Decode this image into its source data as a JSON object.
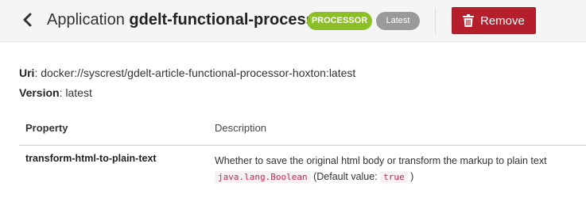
{
  "header": {
    "title_prefix": "Application",
    "app_name": "gdelt-functional-processor",
    "type_badge": "PROCESSOR",
    "version_badge": "Latest",
    "remove_label": "Remove",
    "icons": {
      "back": "chevron-left-icon",
      "remove": "trash-icon"
    },
    "colors": {
      "type_badge": "#8cbf26",
      "version_badge": "#9a9a9a",
      "remove_button": "#b51f2b"
    }
  },
  "details": {
    "uri_label": "Uri",
    "uri_value": "docker://syscrest/gdelt-article-functional-processor-hoxton:latest",
    "version_label": "Version",
    "version_value": "latest"
  },
  "properties_table": {
    "columns": [
      "Property",
      "Description"
    ],
    "rows": [
      {
        "property": "transform-html-to-plain-text",
        "description": "Whether to save the original html body or transform the markup to plain text",
        "type": "java.lang.Boolean",
        "default_prefix": "(Default value:",
        "default_value": "true",
        "default_suffix": ")"
      }
    ]
  }
}
